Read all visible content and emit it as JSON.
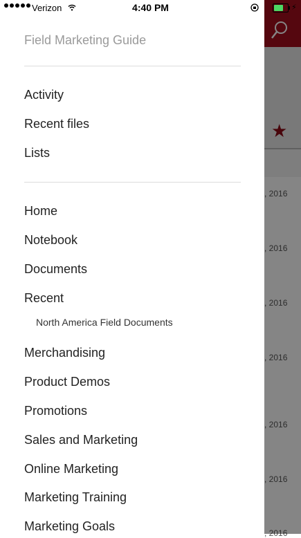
{
  "status_bar": {
    "carrier": "Verizon",
    "time": "4:40 PM"
  },
  "drawer": {
    "title": "Field Marketing Guide",
    "group1": [
      "Activity",
      "Recent files",
      "Lists"
    ],
    "group2": {
      "home": "Home",
      "notebook": "Notebook",
      "documents": "Documents",
      "recent": "Recent",
      "recent_sub": "North America Field Documents",
      "merchandising": "Merchandising",
      "product_demos": "Product Demos",
      "promotions": "Promotions",
      "sales_marketing": "Sales and Marketing",
      "online_marketing": "Online Marketing",
      "marketing_training": "Marketing Training",
      "marketing_goals": "Marketing Goals"
    }
  },
  "background": {
    "dates": [
      ", 2016",
      ", 2016",
      ", 2016",
      ", 2016",
      ", 2016",
      ", 2016",
      ", 2016"
    ]
  },
  "colors": {
    "header": "#a30e1e",
    "star": "#8a0a16"
  }
}
